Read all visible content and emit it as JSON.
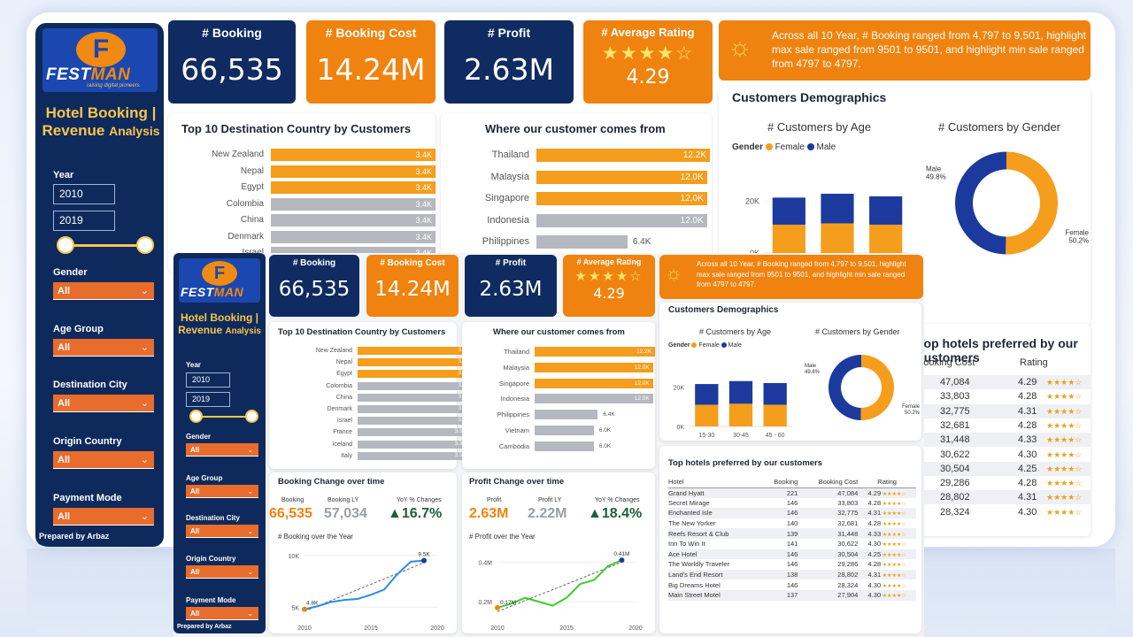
{
  "brand": {
    "logo_letter": "F",
    "name_a": "FEST",
    "name_b": "MAN",
    "tagline": "raising digital pioneers"
  },
  "app": {
    "title_line1": "Hotel Booking |",
    "title_line2": "Revenue",
    "title_line2b": "Analysis",
    "prepared": "Prepared by Arbaz"
  },
  "filters": {
    "year_label": "Year",
    "year_from": "2010",
    "year_to": "2019",
    "gender_label": "Gender",
    "gender_value": "All",
    "age_label": "Age Group",
    "age_value": "All",
    "city_label": "Destination City",
    "city_value": "All",
    "origin_label": "Origin Country",
    "origin_value": "All",
    "payment_label": "Payment Mode",
    "payment_value": "All"
  },
  "kpis": {
    "booking_label": "# Booking",
    "booking_value": "66,535",
    "cost_label": "# Booking Cost",
    "cost_value": "14.24M",
    "profit_label": "# Profit",
    "profit_value": "2.63M",
    "rating_label": "# Average Rating",
    "rating_value": "4.29",
    "rating_stars": "★★★★☆"
  },
  "insight": {
    "text": "Across all 10 Year, # Booking ranged from 4,797 to 9,501, highlight max sale ranged from 9501 to 9501, and highlight min sale ranged from 4797 to 4797."
  },
  "colors": {
    "navy": "#0f2b61",
    "orange": "#f0830f",
    "bar_orange": "#f59d1c",
    "bar_grey": "#b5b8be",
    "male": "#1c3a9e",
    "female": "#f59d1c"
  },
  "destination": {
    "title": "Top 10 Destination Country by Customers",
    "rows": [
      {
        "country": "New Zealand",
        "value": "3.4K",
        "hl": true
      },
      {
        "country": "Nepal",
        "value": "3.4K",
        "hl": true
      },
      {
        "country": "Egypt",
        "value": "3.4K",
        "hl": true
      },
      {
        "country": "Colombia",
        "value": "3.4K",
        "hl": false
      },
      {
        "country": "China",
        "value": "3.4K",
        "hl": false
      },
      {
        "country": "Denmark",
        "value": "3.4K",
        "hl": false
      },
      {
        "country": "Israel",
        "value": "3.4K",
        "hl": false
      },
      {
        "country": "France",
        "value": "3.3K",
        "hl": false
      },
      {
        "country": "Iceland",
        "value": "3.3K",
        "hl": false
      },
      {
        "country": "Italy",
        "value": "3.3K",
        "hl": false
      }
    ]
  },
  "origin": {
    "title": "Where our customer comes from",
    "rows": [
      {
        "country": "Thailand",
        "value": "12.2K",
        "num": 12.2,
        "hl": true
      },
      {
        "country": "Malaysia",
        "value": "12.0K",
        "num": 12.0,
        "hl": true
      },
      {
        "country": "Singapore",
        "value": "12.0K",
        "num": 12.0,
        "hl": true
      },
      {
        "country": "Indonesia",
        "value": "12.0K",
        "num": 12.0,
        "hl": false
      },
      {
        "country": "Philippines",
        "value": "6.4K",
        "num": 6.4,
        "hl": false
      },
      {
        "country": "Vietnam",
        "value": "6.0K",
        "num": 6.0,
        "hl": false
      },
      {
        "country": "Cambodia",
        "value": "6.0K",
        "num": 6.0,
        "hl": false
      }
    ]
  },
  "demographics": {
    "title": "Customers Demographics",
    "age_title": "# Customers by Age",
    "gender_title": "# Customers by Gender",
    "legend_label": "Gender",
    "female": "Female",
    "male": "Male",
    "y_ticks": [
      "20K",
      "0K"
    ],
    "age_groups": [
      "15-30",
      "30-45",
      "45 - 60"
    ],
    "male_label": "Male",
    "male_pct": "49.8%",
    "female_label": "Female",
    "female_pct": "50.2%"
  },
  "chart_data": [
    {
      "type": "bar",
      "title": "# Customers by Age",
      "categories": [
        "15-30",
        "30-45",
        "45 - 60"
      ],
      "series": [
        {
          "name": "Female",
          "values": [
            11000,
            11500,
            11000
          ]
        },
        {
          "name": "Male",
          "values": [
            10500,
            11500,
            11000
          ]
        }
      ],
      "ylim": [
        0,
        35000
      ]
    },
    {
      "type": "pie",
      "title": "# Customers by Gender",
      "categories": [
        "Male",
        "Female"
      ],
      "values": [
        49.8,
        50.2
      ]
    },
    {
      "type": "line",
      "title": "# Booking over the Year",
      "x": [
        2010,
        2011,
        2012,
        2013,
        2014,
        2015,
        2016,
        2017,
        2018,
        2019
      ],
      "values": [
        4797,
        5100,
        5500,
        5700,
        5800,
        6200,
        6700,
        8200,
        9400,
        9501
      ],
      "y_ticks": [
        "10K",
        "5K"
      ],
      "x_ticks": [
        "2010",
        "2015",
        "2020"
      ],
      "start_label": "4.8K",
      "end_label": "9.5K",
      "ylim": [
        4000,
        10500
      ]
    },
    {
      "type": "line",
      "title": "# Profit over the Year",
      "x": [
        2010,
        2011,
        2012,
        2013,
        2014,
        2015,
        2016,
        2017,
        2018,
        2019
      ],
      "values": [
        0.17,
        0.19,
        0.22,
        0.2,
        0.18,
        0.22,
        0.29,
        0.31,
        0.38,
        0.41
      ],
      "y_ticks": [
        "0.4M",
        "0.2M"
      ],
      "x_ticks": [
        "2010",
        "2015",
        "2020"
      ],
      "min_label": "0.17M",
      "end_label": "0.41M",
      "ylim": [
        0.12,
        0.46
      ]
    }
  ],
  "booking_change": {
    "title": "Booking Change over time",
    "col1": "Booking",
    "col2": "Booking LY",
    "col3": "YoY % Changes",
    "v1": "66,535",
    "v2": "57,034",
    "v3": "▲16.7%",
    "chart_title": "# Booking over the Year"
  },
  "profit_change": {
    "title": "Profit Change over time",
    "col1": "Profit",
    "col2": "Profit LY",
    "col3": "YoY % Changes",
    "v1": "2.63M",
    "v2": "2.22M",
    "v3": "▲18.4%",
    "chart_title": "# Profit over the Year"
  },
  "hotels": {
    "title": "Top hotels preferred by our customers",
    "headers": [
      "Hotel",
      "Booking",
      "Booking Cost",
      "Rating"
    ],
    "rows": [
      [
        "Grand Hyatt",
        "221",
        "47,084",
        "4.29"
      ],
      [
        "Secret Mirage",
        "146",
        "33,803",
        "4.28"
      ],
      [
        "Enchanted Isle",
        "146",
        "32,775",
        "4.31"
      ],
      [
        "The New Yorker",
        "140",
        "32,681",
        "4.28"
      ],
      [
        "Reefs Resort & Club",
        "139",
        "31,448",
        "4.33"
      ],
      [
        "Inn To Win It",
        "141",
        "30,622",
        "4.30"
      ],
      [
        "Ace Hotel",
        "146",
        "30,504",
        "4.25"
      ],
      [
        "The Worldly Traveler",
        "146",
        "29,286",
        "4.28"
      ],
      [
        "Land's End Resort",
        "138",
        "28,802",
        "4.31"
      ],
      [
        "Big Dreams Hotel",
        "146",
        "28,324",
        "4.30"
      ],
      [
        "Main Street Motel",
        "137",
        "27,904",
        "4.30"
      ]
    ],
    "bg_title": "Top hotels preferred by our customers",
    "bg_cost_header": "Booking Cost",
    "bg_rating_header": "Rating"
  }
}
